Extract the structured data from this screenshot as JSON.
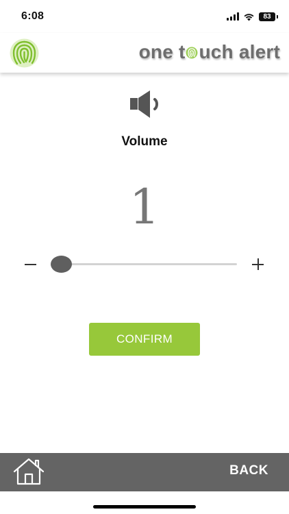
{
  "status_bar": {
    "time": "6:08",
    "battery": "83",
    "icons": [
      "signal-icon",
      "wifi-icon",
      "battery-icon"
    ]
  },
  "header": {
    "brand_prefix": "one t",
    "brand_suffix": "uch alert",
    "logo_icon": "fingerprint-icon",
    "accent_color": "#97c83a"
  },
  "volume": {
    "icon": "speaker-icon",
    "label": "Volume",
    "value": "1",
    "slider_level": 0
  },
  "actions": {
    "confirm_label": "CONFIRM",
    "back_label": "BACK",
    "home_icon": "home-icon"
  }
}
